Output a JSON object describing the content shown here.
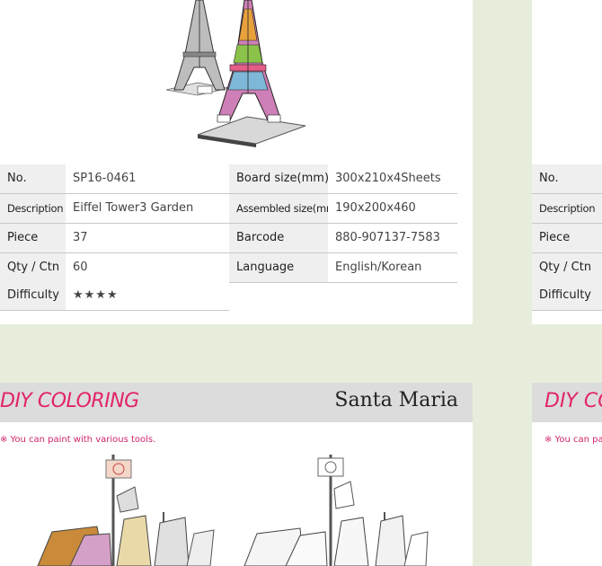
{
  "product_top": {
    "spec_rows": [
      {
        "label1": "No.",
        "value1": "SP16-0461",
        "label2": "Board size(mm)",
        "value2": "300x210x4Sheets"
      },
      {
        "label1": "Description",
        "value1": "Eiffel Tower3 Garden",
        "label2": "Assembled size(mm)",
        "value2": "190x200x460"
      },
      {
        "label1": "Piece",
        "value1": "37",
        "label2": "Barcode",
        "value2": "880-907137-7583"
      },
      {
        "label1": "Qty / Ctn",
        "value1": "60",
        "label2": "Language",
        "value2": "English/Korean"
      }
    ],
    "difficulty_label": "Difficulty",
    "difficulty_value": "★★★★"
  },
  "product_top_right_partial": {
    "labels": [
      "No.",
      "Description",
      "Piece",
      "Qty / Ctn",
      "Difficulty"
    ]
  },
  "product_bottom": {
    "banner_title": "DIY COLORING",
    "banner_name": "Santa Maria",
    "note": "※ You can paint with various tools."
  },
  "product_bottom_right_partial": {
    "banner_title": "DIY CO",
    "note": "※ You can pa"
  },
  "colors": {
    "background": "#e6eedb",
    "accent_pink": "#e2246a",
    "banner_gray": "#dcdcdc",
    "label_gray": "#efefef"
  }
}
